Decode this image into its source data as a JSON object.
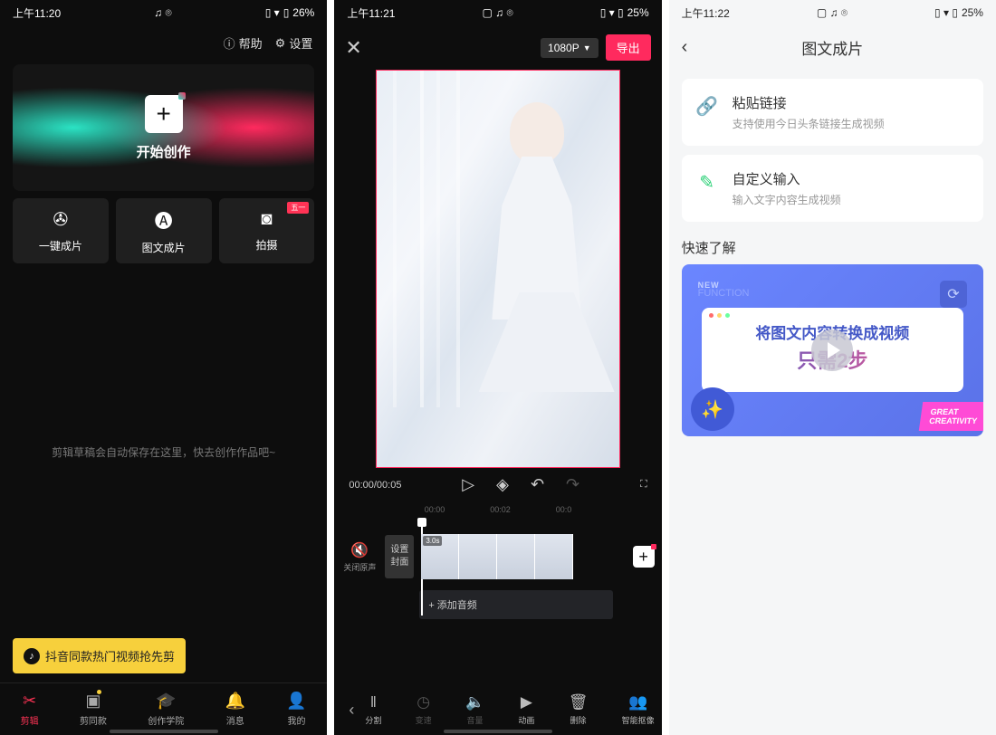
{
  "p1": {
    "status": {
      "time": "上午11:20",
      "battery": "26%"
    },
    "top": {
      "help": "帮助",
      "settings": "设置"
    },
    "hero_label": "开始创作",
    "tiles": [
      {
        "label": "一键成片"
      },
      {
        "label": "图文成片"
      },
      {
        "label": "拍摄",
        "badge": "五一"
      }
    ],
    "hint": "剪辑草稿会自动保存在这里，快去创作作品吧~",
    "toast": "抖音同款热门视频抢先剪",
    "nav": [
      {
        "label": "剪辑"
      },
      {
        "label": "剪同款"
      },
      {
        "label": "创作学院"
      },
      {
        "label": "消息"
      },
      {
        "label": "我的"
      }
    ]
  },
  "p2": {
    "status": {
      "time": "上午11:21",
      "battery": "25%"
    },
    "resolution": "1080P",
    "export": "导出",
    "time_current": "00:00/00:05",
    "ruler": [
      "00:00",
      "00:02",
      "00:0"
    ],
    "mute_label": "关闭原声",
    "cover_label": "设置\n封面",
    "clip_duration": "3.0s",
    "audio_hint": "+ 添加音频",
    "tools": [
      {
        "label": "分割"
      },
      {
        "label": "变速",
        "disabled": true
      },
      {
        "label": "音量",
        "disabled": true
      },
      {
        "label": "动画"
      },
      {
        "label": "删除"
      },
      {
        "label": "智能抠像"
      }
    ]
  },
  "p3": {
    "status": {
      "time": "上午11:22",
      "battery": "25%"
    },
    "title": "图文成片",
    "cards": [
      {
        "title": "粘贴链接",
        "sub": "支持使用今日头条链接生成视频"
      },
      {
        "title": "自定义输入",
        "sub": "输入文字内容生成视频"
      }
    ],
    "section": "快速了解",
    "promo": {
      "tag1": "NEW",
      "tag2": "FUNCTION",
      "line1": "将图文内容转换成视频",
      "line2": "只需2步",
      "footer": "GREAT\nCREATIVITY"
    }
  }
}
